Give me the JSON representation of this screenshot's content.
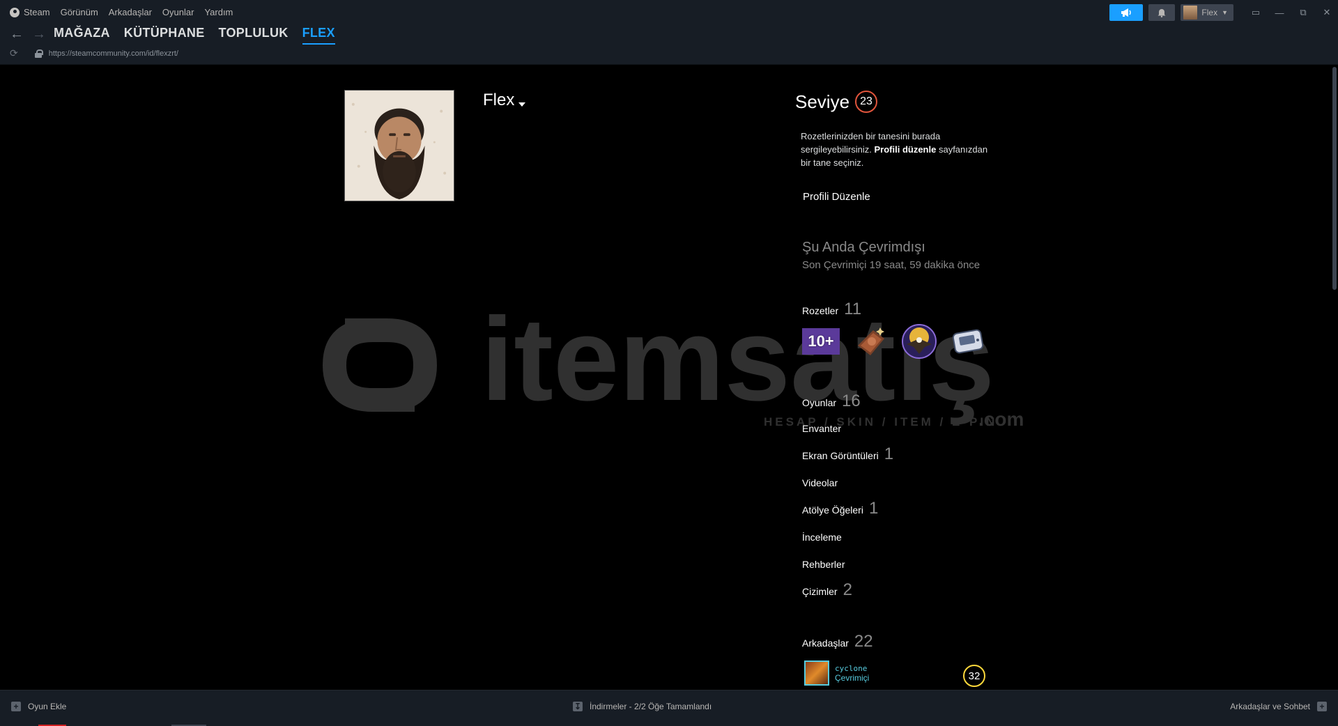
{
  "window": {
    "menu": [
      "Steam",
      "Görünüm",
      "Arkadaşlar",
      "Oyunlar",
      "Yardım"
    ],
    "user_name": "Flex"
  },
  "nav": {
    "tabs": [
      "MAĞAZA",
      "KÜTÜPHANE",
      "TOPLULUK",
      "FLEX"
    ],
    "active_tab": "FLEX",
    "url": "https://steamcommunity.com/id/flexzrt/"
  },
  "profile": {
    "persona_name": "Flex",
    "level_label": "Seviye",
    "level": "23",
    "showcase_note_pre": "Rozetlerinizden bir tanesini burada sergileyebilirsiniz.",
    "showcase_note_link": "Profili düzenle",
    "showcase_note_post": "sayfanızdan bir tane seçiniz.",
    "edit_button": "Profili Düzenle",
    "status_title": "Şu Anda Çevrimdışı",
    "status_sub": "Son Çevrimiçi 19 saat, 59 dakika önce"
  },
  "stats": {
    "badges_label": "Rozetler",
    "badges_count": "11",
    "games_label": "Oyunlar",
    "games_count": "16",
    "inventory_label": "Envanter",
    "screenshots_label": "Ekran Görüntüleri",
    "screenshots_count": "1",
    "videos_label": "Videolar",
    "workshop_label": "Atölye Öğeleri",
    "workshop_count": "1",
    "reviews_label": "İnceleme",
    "guides_label": "Rehberler",
    "artwork_label": "Çizimler",
    "artwork_count": "2",
    "friends_label": "Arkadaşlar",
    "friends_count": "22"
  },
  "badges": {
    "first_badge_text": "10+",
    "icons": [
      "years-of-service-badge",
      "chocolate-badge",
      "eagle-badge",
      "device-badge"
    ]
  },
  "friend": {
    "name": "cyclone",
    "status": "Çevrimiçi",
    "level": "32"
  },
  "watermark": {
    "brand": "itemsatış",
    "tagline": "HESAP / SKIN / ITEM / E-PIN",
    "suffix": ".com"
  },
  "bottom": {
    "add_game": "Oyun Ekle",
    "downloads": "İndirmeler - 2/2 Öğe Tamamlandı",
    "friends_chat": "Arkadaşlar ve Sohbet"
  },
  "colors": {
    "accent": "#1a9fff",
    "level_ring": "#e1553c",
    "friend_online": "#57cbde",
    "friend_level_ring": "#ffd93b"
  }
}
